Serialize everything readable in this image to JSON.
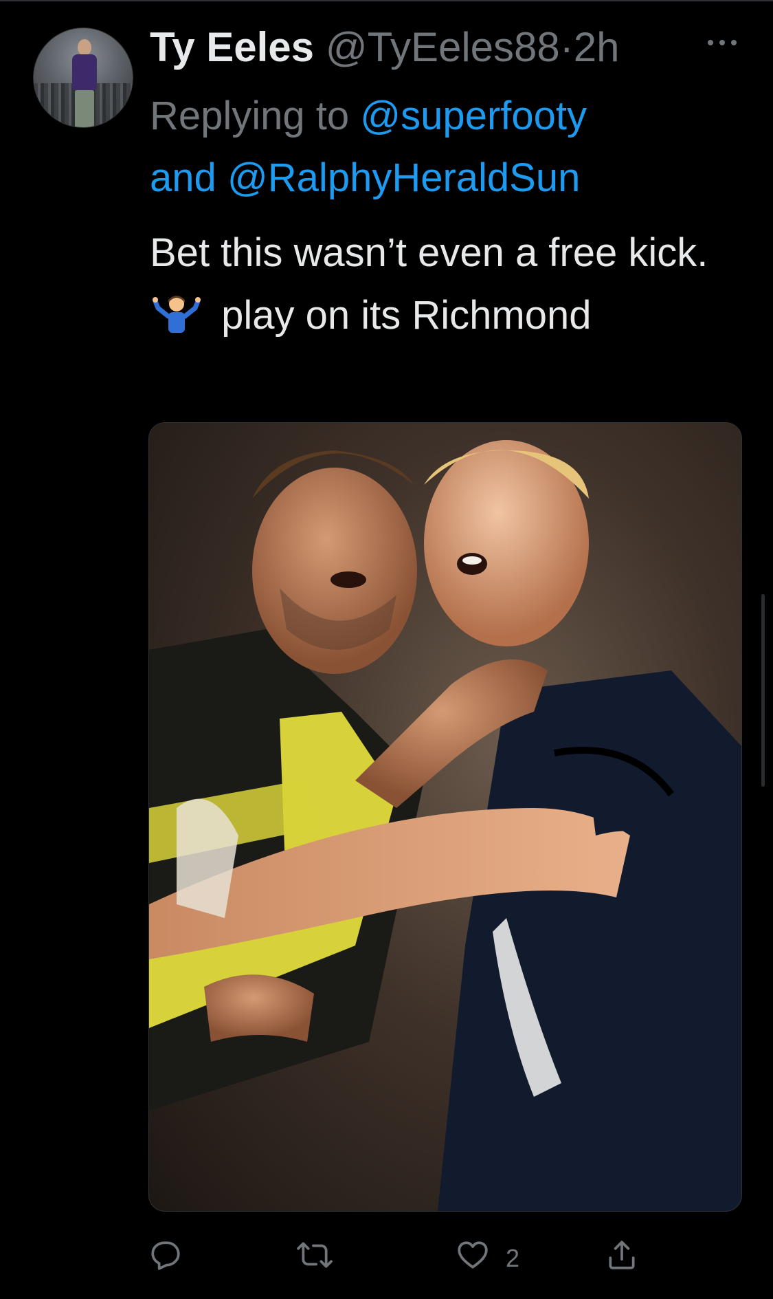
{
  "tweet": {
    "author_name": "Ty Eeles",
    "author_handle": "@TyEeles88",
    "separator": "·",
    "timestamp": "2h",
    "replying_prefix": "Replying to",
    "reply_to_1": "@superfooty",
    "reply_conjunction": "and",
    "reply_to_2": "@RalphyHeraldSun",
    "text_before_emoji": "Bet this wasn’t even a free kick.",
    "emoji_name": "person-shrugging-emoji",
    "text_after_emoji": "play on its Richmond",
    "media_description_icon": "photo"
  },
  "actions": {
    "reply_icon": "reply-icon",
    "retweet_icon": "retweet-icon",
    "like_icon": "like-icon",
    "like_count": "2",
    "share_icon": "share-icon"
  },
  "colors": {
    "background": "#000000",
    "text": "#e7e9ea",
    "secondary": "#71767b",
    "link": "#1d9bf0"
  }
}
